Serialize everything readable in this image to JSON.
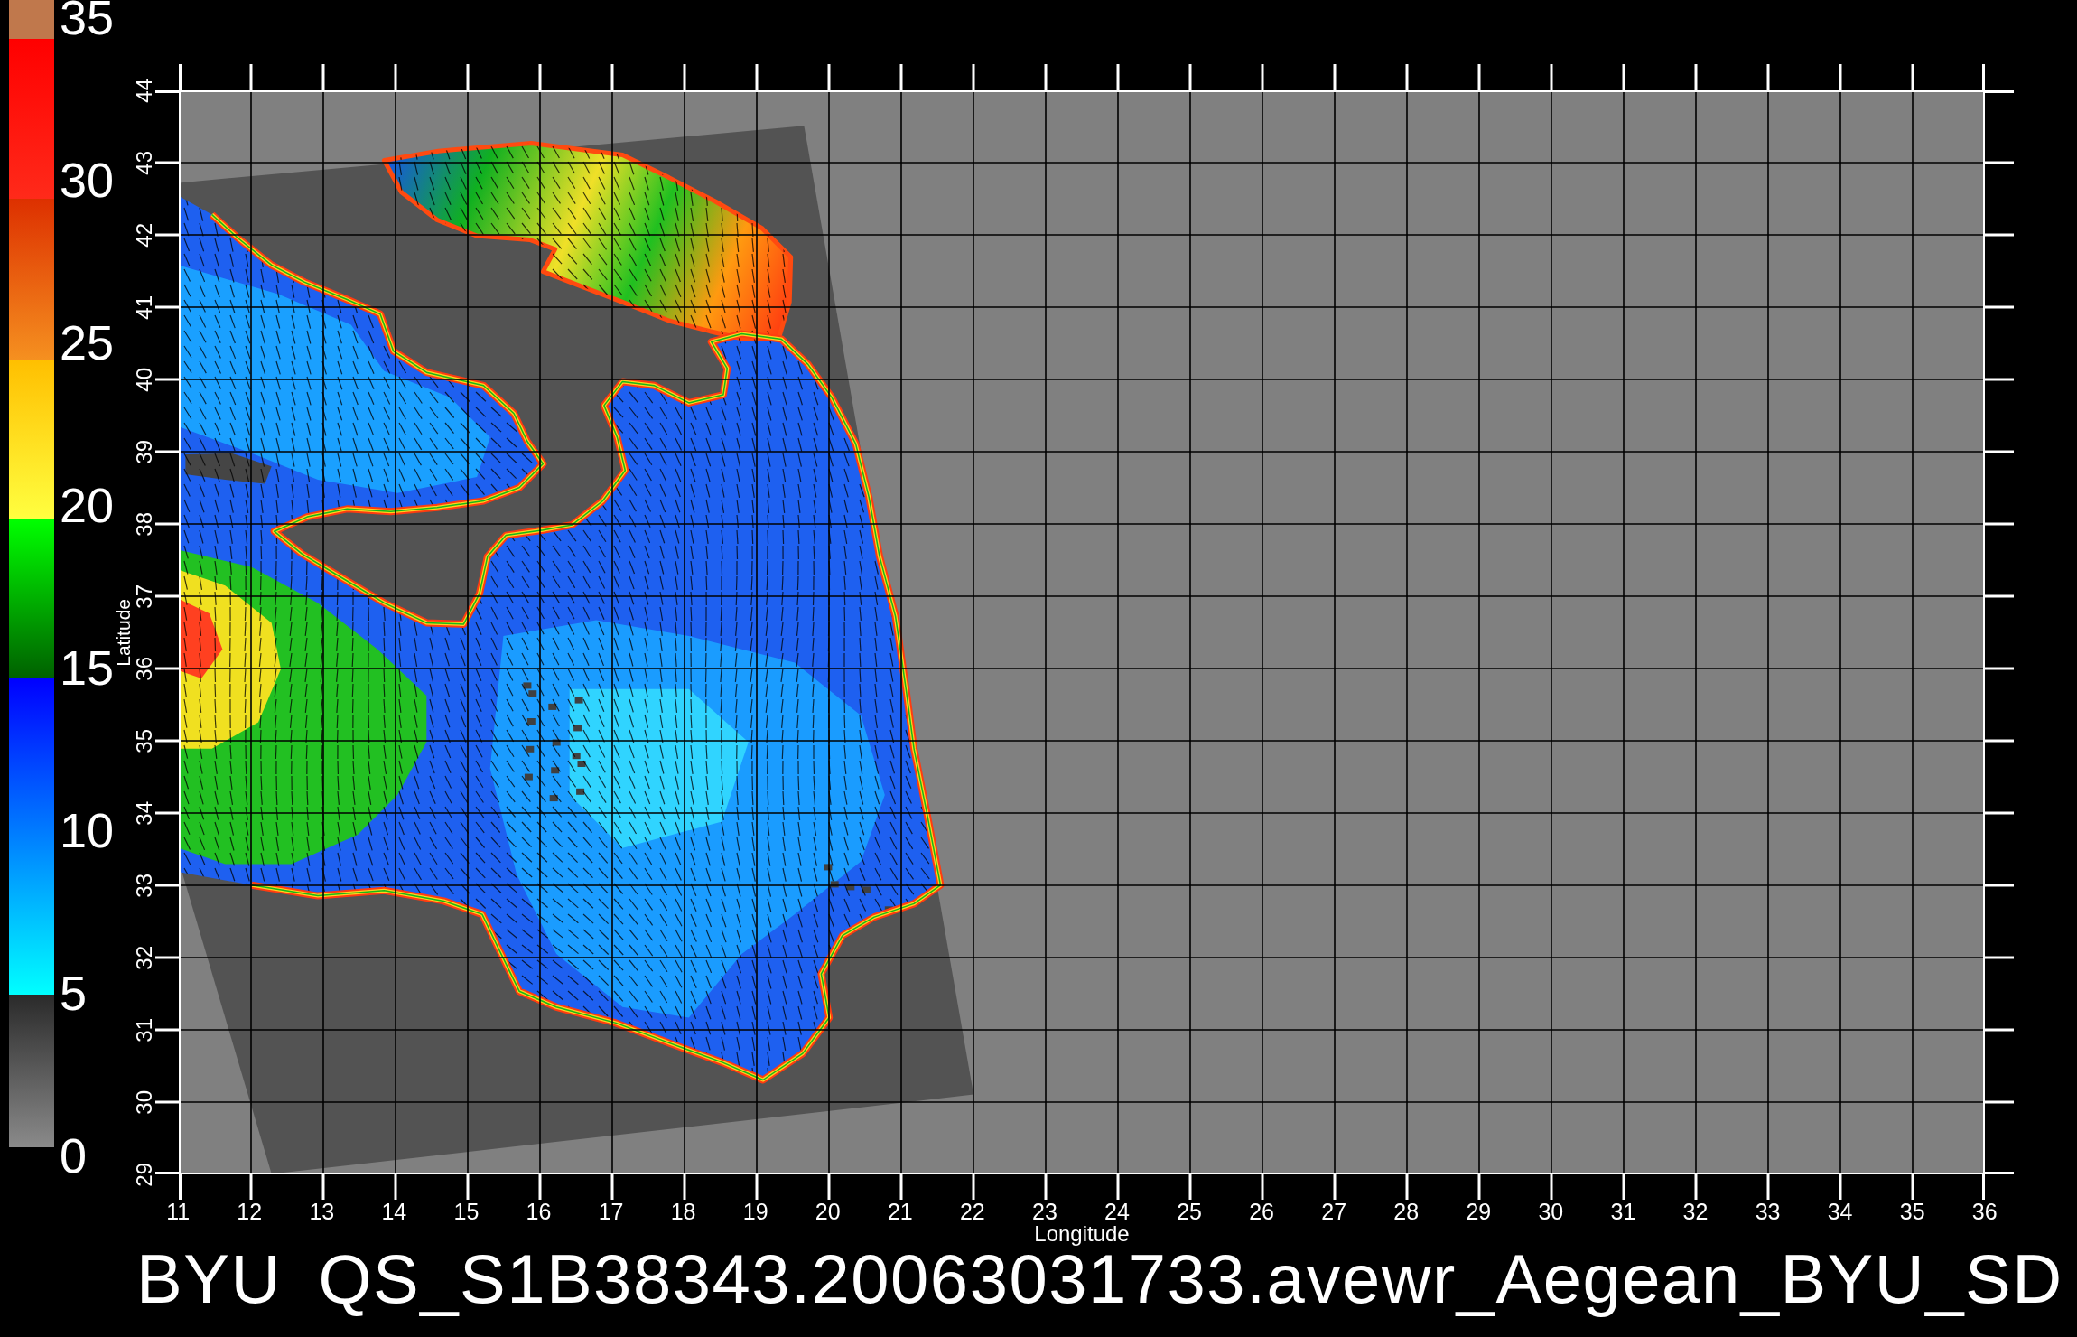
{
  "color_scale": {
    "tick_labels": [
      "35",
      "30",
      "25",
      "20",
      "15",
      "10",
      "5",
      "0"
    ]
  },
  "plot": {
    "y_axis": {
      "title": "Latitude",
      "tick_labels": [
        "44",
        "43",
        "42",
        "41",
        "40",
        "39",
        "38",
        "37",
        "36",
        "35",
        "34",
        "33",
        "32",
        "31",
        "30",
        "29"
      ]
    },
    "x_axis": {
      "title": "Longitude",
      "tick_labels": [
        "11",
        "12",
        "13",
        "14",
        "15",
        "16",
        "17",
        "18",
        "19",
        "20",
        "21",
        "22",
        "23",
        "24",
        "25",
        "26",
        "27",
        "28",
        "29",
        "30",
        "31",
        "32",
        "33",
        "34",
        "35",
        "36"
      ]
    }
  },
  "title": "BYU QS_S1B38343.20063031733.avewr_Aegean_BYU_SD"
}
